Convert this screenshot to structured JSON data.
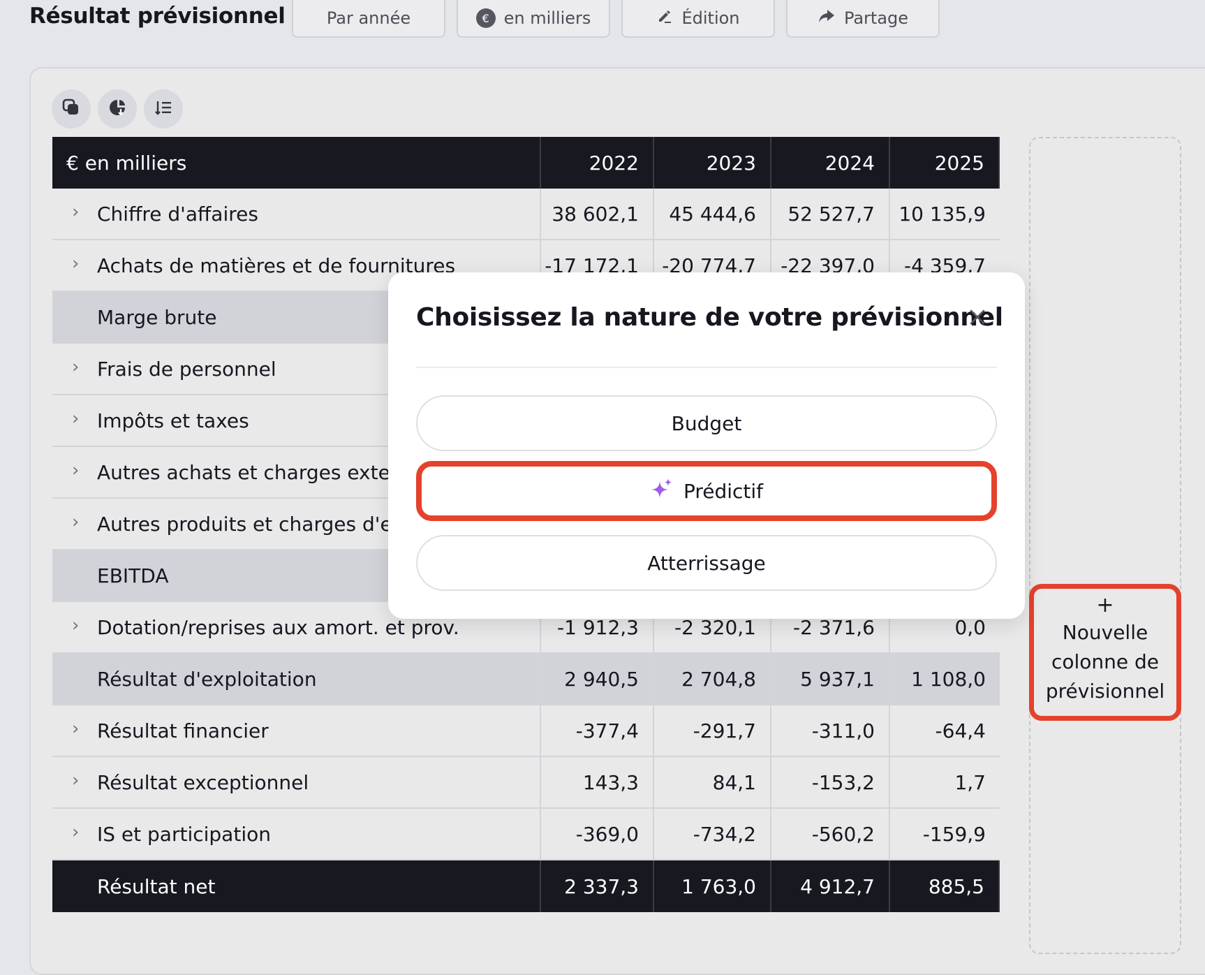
{
  "header": {
    "title": "Résultat prévisionnel",
    "buttons": {
      "par_annee": "Par année",
      "en_milliers": "en milliers",
      "edition": "Édition",
      "partage": "Partage"
    }
  },
  "table": {
    "header": {
      "label": "€ en milliers",
      "years": [
        "2022",
        "2023",
        "2024",
        "2025"
      ]
    },
    "rows": [
      {
        "label": "Chiffre d'affaires",
        "values": [
          "38 602,1",
          "45 444,6",
          "52 527,7",
          "10 135,9"
        ]
      },
      {
        "label": "Achats de matières et de fournitures",
        "values": [
          "-17 172,1",
          "-20 774,7",
          "-22 397,0",
          "-4 359,7"
        ]
      },
      {
        "label": "Marge brute"
      },
      {
        "label": "Frais de personnel"
      },
      {
        "label": "Impôts et taxes"
      },
      {
        "label": "Autres achats et charges exte"
      },
      {
        "label": "Autres produits et charges d'e"
      },
      {
        "label": "EBITDA"
      },
      {
        "label": "Dotation/reprises aux amort. et prov.",
        "values": [
          "-1 912,3",
          "-2 320,1",
          "-2 371,6",
          "0,0"
        ]
      },
      {
        "label": "Résultat d'exploitation",
        "values": [
          "2 940,5",
          "2 704,8",
          "5 937,1",
          "1 108,0"
        ]
      },
      {
        "label": "Résultat financier",
        "values": [
          "-377,4",
          "-291,7",
          "-311,0",
          "-64,4"
        ]
      },
      {
        "label": "Résultat exceptionnel",
        "values": [
          "143,3",
          "84,1",
          "-153,2",
          "1,7"
        ]
      },
      {
        "label": "IS et participation",
        "values": [
          "-369,0",
          "-734,2",
          "-560,2",
          "-159,9"
        ]
      },
      {
        "label": "Résultat net",
        "values": [
          "2 337,3",
          "1 763,0",
          "4 912,7",
          "885,5"
        ]
      }
    ]
  },
  "add_column": {
    "plus": "+",
    "line1": "Nouvelle",
    "line2": "colonne de",
    "line3": "prévisionnel"
  },
  "modal": {
    "title": "Choisissez la nature de votre prévisionnel",
    "options": {
      "budget": "Budget",
      "predictif": "Prédictif",
      "atterrissage": "Atterrissage"
    }
  },
  "colors": {
    "highlight": "#e4422c",
    "dark_row": "#181920",
    "sparkle": "#a35be8"
  }
}
